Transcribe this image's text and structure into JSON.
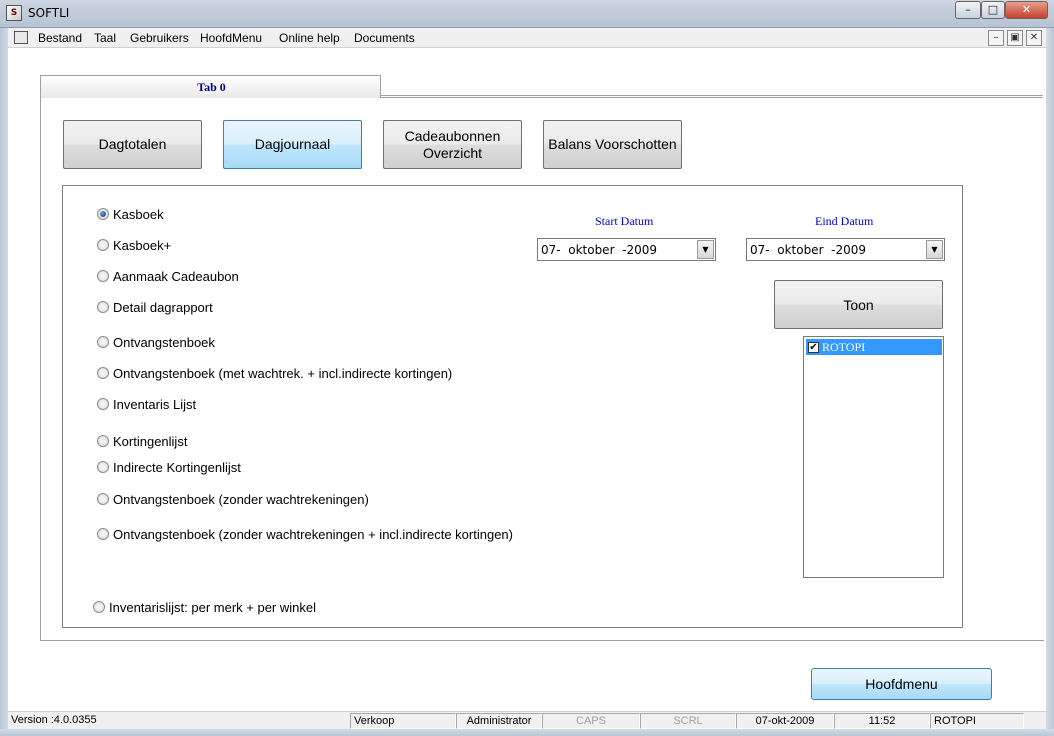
{
  "window": {
    "title": "SOFTLI",
    "app_icon": "softli-logo-icon",
    "controls": [
      "minimize",
      "maximize",
      "close"
    ]
  },
  "menubar": {
    "items": [
      "Bestand",
      "Taal",
      "Gebruikers",
      "HoofdMenu",
      "Online help",
      "Documents"
    ]
  },
  "tabs": [
    {
      "label": "Tab 0",
      "selected": true
    }
  ],
  "report_buttons": [
    {
      "label": "Dagtotalen",
      "active": false
    },
    {
      "label": "Dagjournaal",
      "active": true
    },
    {
      "label": "Cadeaubonnen Overzicht",
      "active": false
    },
    {
      "label": "Balans Voorschotten",
      "active": false
    }
  ],
  "report_options": [
    {
      "label": "Kasboek",
      "checked": true
    },
    {
      "label": "Kasboek+",
      "checked": false
    },
    {
      "label": "Aanmaak Cadeaubon",
      "checked": false
    },
    {
      "label": "Detail dagrapport",
      "checked": false
    },
    {
      "label": "Ontvangstenboek",
      "checked": false
    },
    {
      "label": "Ontvangstenboek (met wachtrek. + incl.indirecte kortingen)",
      "checked": false
    },
    {
      "label": "Inventaris Lijst",
      "checked": false
    },
    {
      "label": "Kortingenlijst",
      "checked": false
    },
    {
      "label": "Indirecte Kortingenlijst",
      "checked": false
    },
    {
      "label": "Ontvangstenboek (zonder wachtrekeningen)",
      "checked": false
    },
    {
      "label": "Ontvangstenboek (zonder wachtrekeningen + incl.indirecte kortingen)",
      "checked": false
    },
    {
      "label": "Inventarislijst: per merk + per winkel",
      "checked": false
    }
  ],
  "start_date": {
    "label": "Start Datum",
    "value": "07-  oktober  -2009"
  },
  "end_date": {
    "label": "Eind Datum",
    "value": "07-  oktober  -2009"
  },
  "toon_button": "Toon",
  "store_list": [
    {
      "label": "ROTOPI",
      "checked": true,
      "selected": true
    }
  ],
  "hoofdmenu_button": "Hoofdmenu",
  "statusbar": {
    "version": "Version :4.0.0355",
    "mode": "Verkoop",
    "user": "Administrator",
    "caps": "CAPS",
    "scrl": "SCRL",
    "date": "07-okt-2009",
    "time": "11:52",
    "store": "ROTOPI"
  }
}
